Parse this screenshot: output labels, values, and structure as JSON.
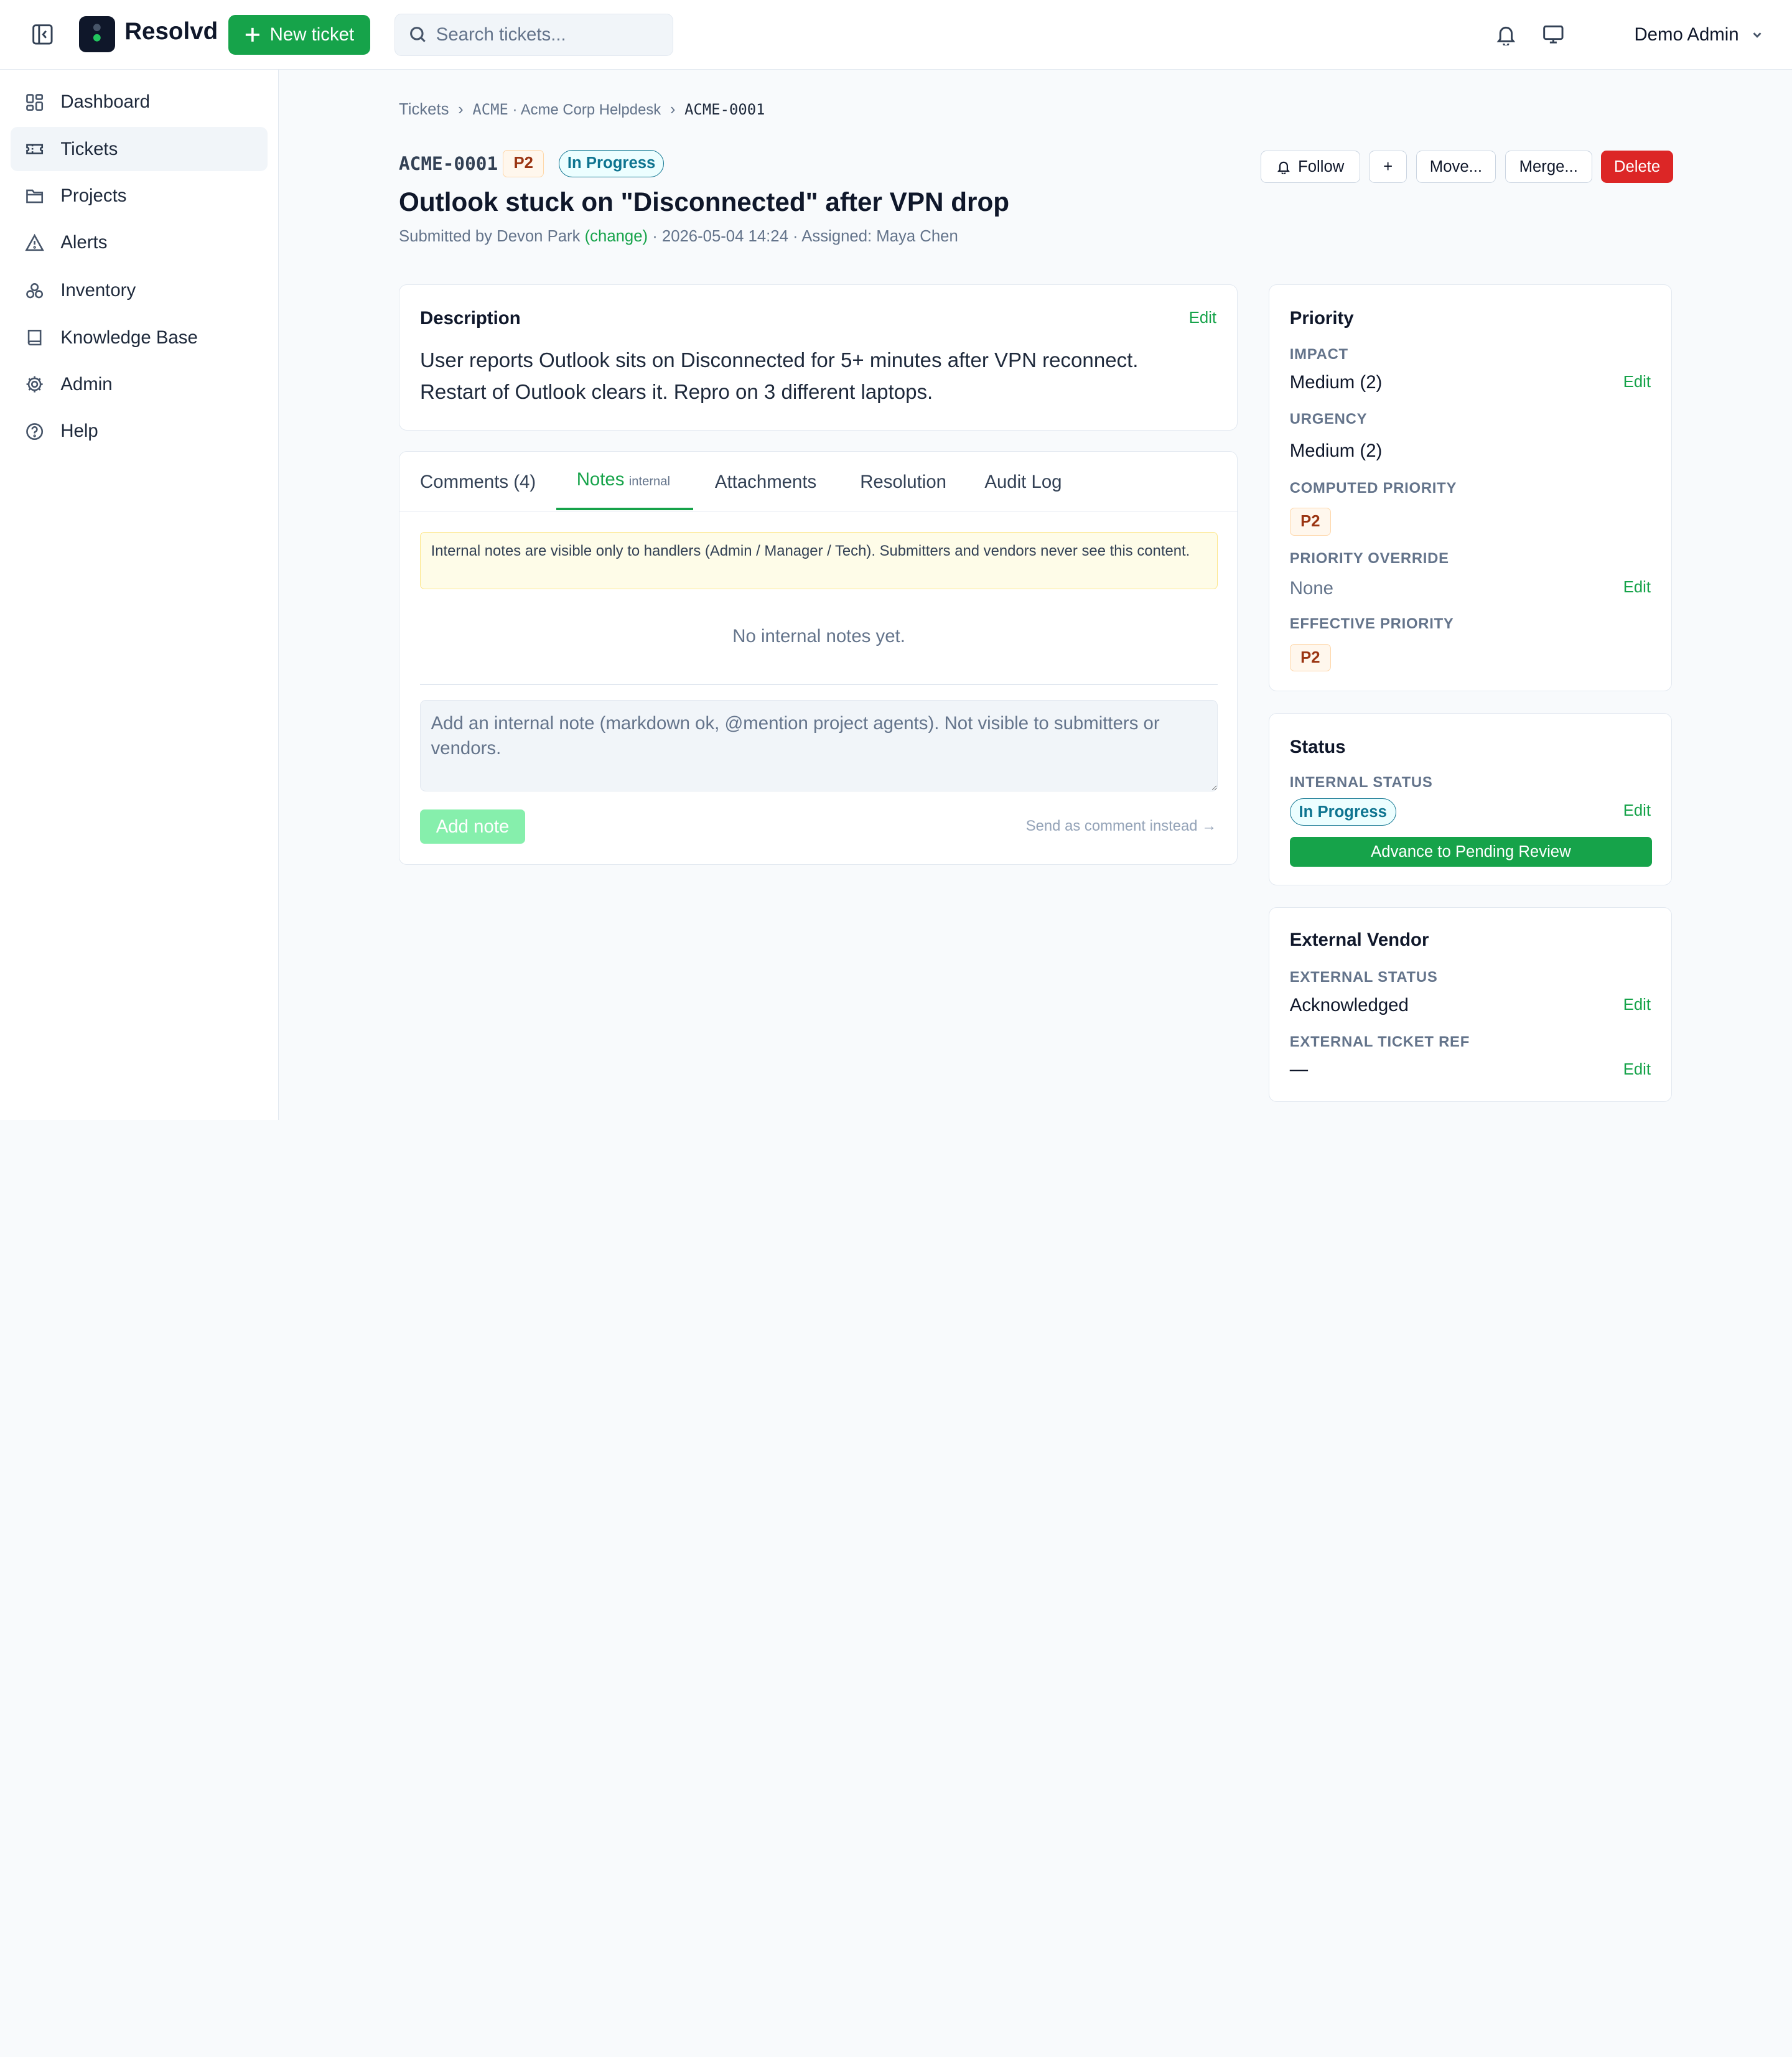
{
  "app": {
    "brand": "Resolvd",
    "new_ticket_label": "New ticket",
    "search_placeholder": "Search tickets...",
    "user_name": "Demo Admin"
  },
  "sidebar": {
    "items": [
      {
        "label": "Dashboard",
        "icon": "dashboard-icon"
      },
      {
        "label": "Tickets",
        "icon": "ticket-icon",
        "active": true
      },
      {
        "label": "Projects",
        "icon": "folder-icon"
      },
      {
        "label": "Alerts",
        "icon": "alert-triangle-icon"
      },
      {
        "label": "Inventory",
        "icon": "inventory-icon"
      },
      {
        "label": "Knowledge Base",
        "icon": "book-icon"
      },
      {
        "label": "Admin",
        "icon": "gear-icon"
      },
      {
        "label": "Help",
        "icon": "help-circle-icon"
      }
    ]
  },
  "breadcrumb": {
    "root": "Tickets",
    "sep": "›",
    "project_key": "ACME",
    "project_sep": "·",
    "project_name": "Acme Corp Helpdesk",
    "current": "ACME-0001"
  },
  "ticket": {
    "id": "ACME-0001",
    "priority": "P2",
    "status": "In Progress",
    "title": "Outlook stuck on \"Disconnected\" after VPN drop",
    "submitted_prefix": "Submitted by Devon Park",
    "change_label": "(change)",
    "meta_suffix": "· 2026-05-04 14:24 · Assigned: Maya Chen"
  },
  "actions": {
    "follow": "Follow",
    "plus": "+",
    "move": "Move...",
    "merge": "Merge...",
    "delete": "Delete"
  },
  "description": {
    "heading": "Description",
    "edit": "Edit",
    "text": "User reports Outlook sits on Disconnected for 5+ minutes after VPN reconnect. Restart of Outlook clears it. Repro on 3 different laptops."
  },
  "tabs": {
    "comments": "Comments (4)",
    "notes": "Notes",
    "notes_sub": "internal",
    "attachments": "Attachments",
    "resolution": "Resolution",
    "audit": "Audit Log",
    "active": "notes"
  },
  "notes": {
    "notice": "Internal notes are visible only to handlers (Admin / Manager / Tech). Submitters and vendors never see this content.",
    "empty": "No internal notes yet.",
    "placeholder": "Add an internal note (markdown ok, @mention project agents). Not visible to submitters or vendors.",
    "add_button": "Add note",
    "send_as_comment": "Send as comment instead →"
  },
  "priority_panel": {
    "heading": "Priority",
    "impact_label": "IMPACT",
    "impact_value": "Medium (2)",
    "urgency_label": "URGENCY",
    "urgency_value": "Medium (2)",
    "computed_label": "COMPUTED PRIORITY",
    "computed_value": "P2",
    "override_label": "PRIORITY OVERRIDE",
    "override_value": "None",
    "effective_label": "EFFECTIVE PRIORITY",
    "effective_value": "P2",
    "edit": "Edit"
  },
  "status_panel": {
    "heading": "Status",
    "internal_label": "INTERNAL STATUS",
    "internal_value": "In Progress",
    "advance_button": "Advance to Pending Review",
    "edit": "Edit"
  },
  "vendor_panel": {
    "heading": "External Vendor",
    "status_label": "EXTERNAL STATUS",
    "status_value": "Acknowledged",
    "ref_label": "EXTERNAL TICKET REF",
    "ref_value": "—",
    "edit": "Edit"
  },
  "colors": {
    "accent": "#16a34a",
    "danger": "#dc2626",
    "status": "#0e7490",
    "priority_bg": "#fff7ed"
  }
}
